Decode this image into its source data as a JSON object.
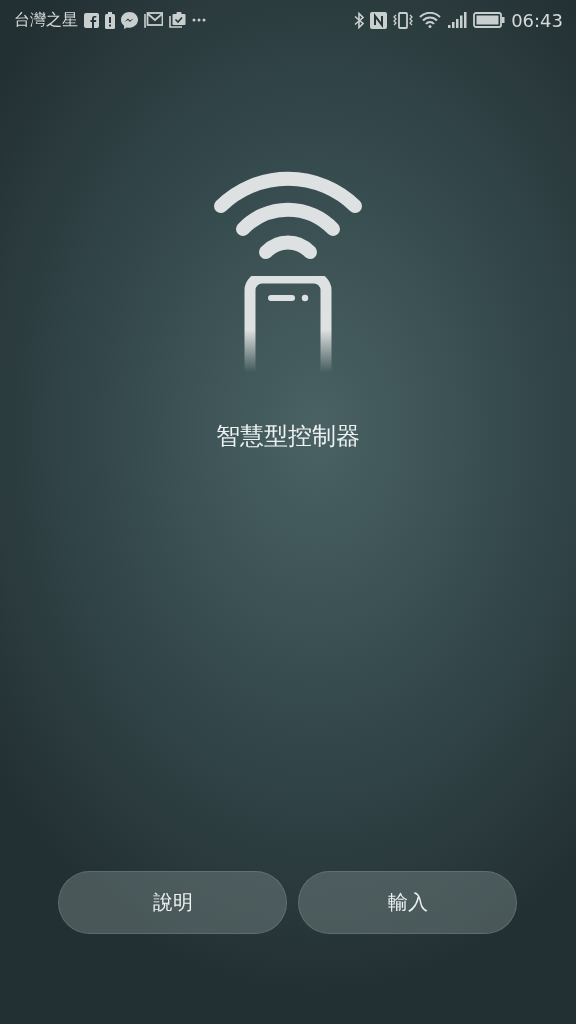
{
  "status_bar": {
    "carrier": "台灣之星",
    "time": "06:43"
  },
  "title": "智慧型控制器",
  "buttons": [
    {
      "label": "說明"
    },
    {
      "label": "輸入"
    }
  ]
}
